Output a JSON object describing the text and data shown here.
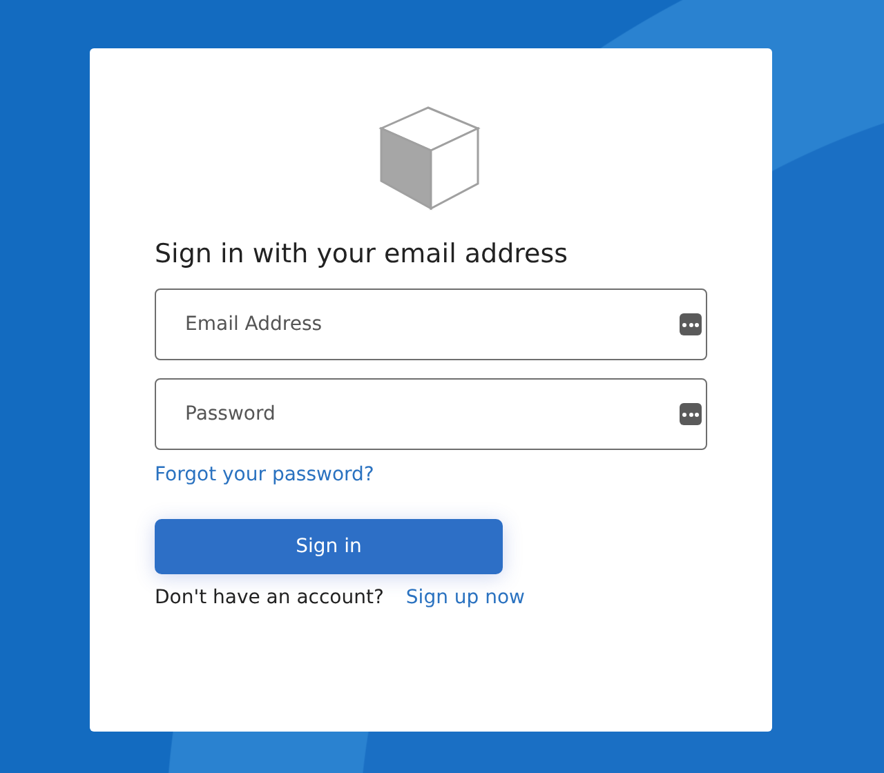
{
  "heading": "Sign in with your email address",
  "fields": [
    {
      "placeholder": "Email Address"
    },
    {
      "placeholder": "Password"
    }
  ],
  "forgot_link": "Forgot your password?",
  "submit_button": "Sign in",
  "signup_prompt": "Don't have an account?",
  "signup_link": "Sign up now"
}
